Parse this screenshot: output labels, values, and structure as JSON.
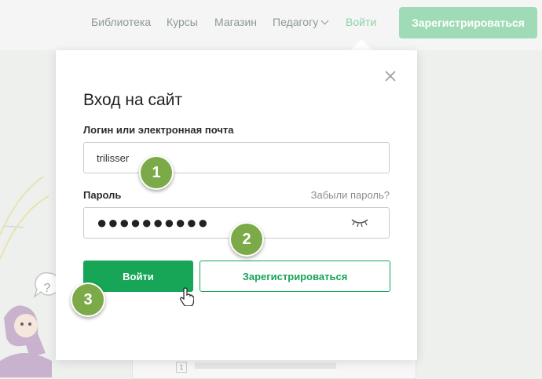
{
  "header": {
    "nav": [
      "Библиотека",
      "Курсы",
      "Магазин",
      "Педагогу",
      "Войти"
    ],
    "register_label": "Зарегистрироваться"
  },
  "background": {
    "badge_number": "1"
  },
  "modal": {
    "title": "Вход на сайт",
    "login_label": "Логин или электронная почта",
    "login_value": "trilisser",
    "password_label": "Пароль",
    "forgot_label": "Забыли пароль?",
    "password_value": "●●●●●●●●●●",
    "login_button": "Войти",
    "register_button": "Зарегистрироваться"
  },
  "annotations": [
    "1",
    "2",
    "3"
  ],
  "colors": {
    "accent": "#17a558",
    "step_badge": "#7caa48"
  },
  "icons": [
    "chevron-down-icon",
    "close-icon",
    "eye-closed-icon",
    "hand-cursor-icon",
    "question-icon"
  ]
}
